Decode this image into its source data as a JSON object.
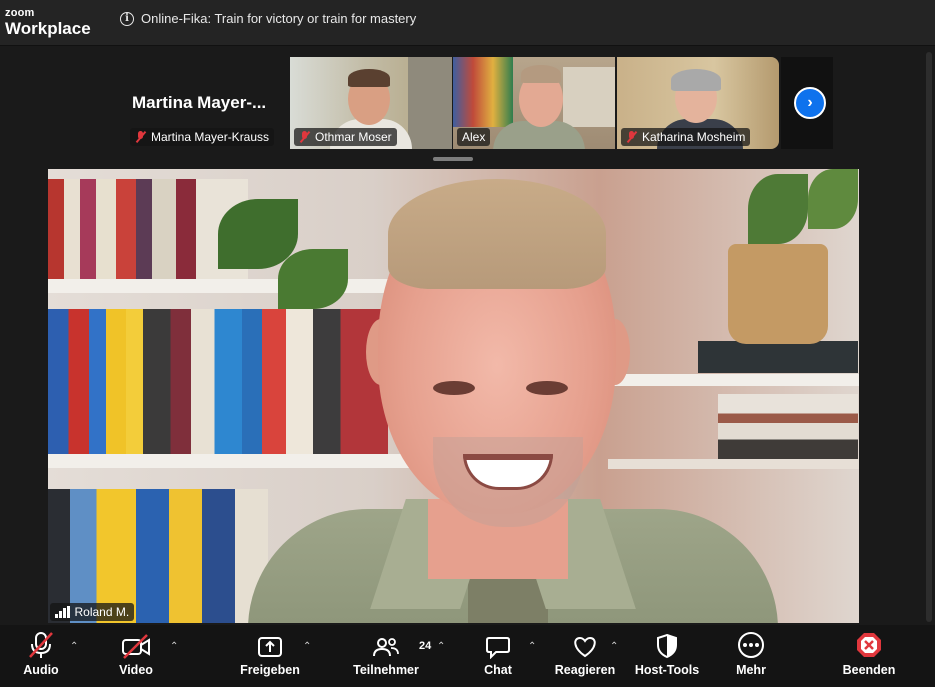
{
  "app": {
    "logo_top": "zoom",
    "logo_bottom": "Workplace",
    "meeting_title": "Online-Fika: Train for victory or train for mastery"
  },
  "gallery": {
    "active_name_large": "Martina  Mayer-...",
    "participants": [
      {
        "name": "Martina Mayer-Krauss",
        "muted": true
      },
      {
        "name": "Othmar Moser",
        "muted": true
      },
      {
        "name": "Alex",
        "muted": false
      },
      {
        "name": "Katharina Mosheim",
        "muted": true
      }
    ],
    "next_icon": "chevron-right-icon"
  },
  "main_video": {
    "speaker_name": "Roland M."
  },
  "toolbar": {
    "audio": "Audio",
    "video": "Video",
    "share": "Freigeben",
    "participants": "Teilnehmer",
    "participants_count": "24",
    "chat": "Chat",
    "react": "Reagieren",
    "host_tools": "Host-Tools",
    "more": "Mehr",
    "end": "Beenden",
    "colors": {
      "end_red": "#e0373d",
      "bar": "#141414",
      "accent_blue": "#0e72ed"
    }
  }
}
